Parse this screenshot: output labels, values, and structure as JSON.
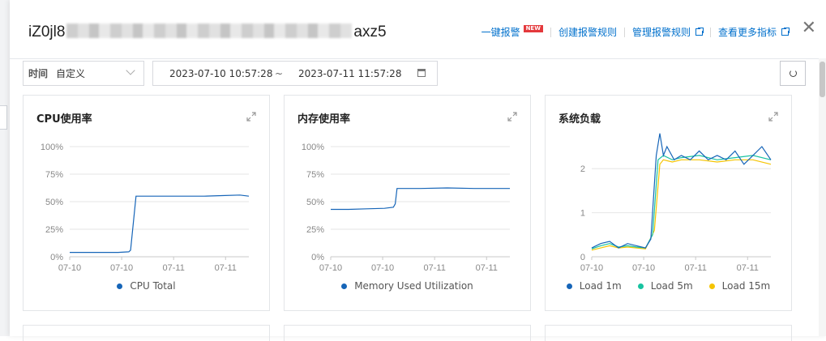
{
  "header": {
    "title_prefix": "iZ0jl8",
    "title_suffix": "axz5",
    "links": [
      {
        "label": "一键报警",
        "badge": "NEW"
      },
      {
        "label": "创建报警规则"
      },
      {
        "label": "管理报警规则"
      },
      {
        "label": "查看更多指标"
      }
    ],
    "close_glyph": "✕"
  },
  "toolbar": {
    "time_label": "时间",
    "time_value": "自定义",
    "range_start": "2023-07-10 10:57:28",
    "range_sep": "~",
    "range_end": "2023-07-11 11:57:28"
  },
  "colors": {
    "link": "#0070cc",
    "series_blue": "#1665b8",
    "series_teal": "#18c3a0",
    "series_yellow": "#f5c400"
  },
  "icons": [
    "expand-icon",
    "calendar-icon",
    "refresh-icon",
    "close-icon",
    "external-link-icon",
    "chevron-down-icon"
  ],
  "charts": [
    {
      "title": "CPU使用率",
      "chart_data": {
        "type": "line",
        "x_ticks": [
          "07-10",
          "07-10",
          "07-11",
          "07-11"
        ],
        "y_ticks": [
          "100%",
          "75%",
          "50%",
          "25%",
          "0%"
        ],
        "ylim": [
          0,
          100
        ],
        "series": [
          {
            "name": "CPU Total",
            "color": "#1665b8",
            "x": [
              0,
              0.2,
              0.27,
              0.33,
              0.34,
              0.37,
              0.45,
              0.55,
              0.65,
              0.75,
              0.85,
              0.95,
              1.0
            ],
            "y": [
              4,
              4,
              4,
              4.5,
              6,
              55,
              55,
              55,
              55,
              55,
              55.5,
              56,
              55
            ]
          }
        ],
        "legend": [
          "CPU Total"
        ]
      }
    },
    {
      "title": "内存使用率",
      "chart_data": {
        "type": "line",
        "x_ticks": [
          "07-10",
          "07-10",
          "07-11",
          "07-11"
        ],
        "y_ticks": [
          "100%",
          "75%",
          "50%",
          "25%",
          "0%"
        ],
        "ylim": [
          0,
          100
        ],
        "series": [
          {
            "name": "Memory Used Utilization",
            "color": "#1665b8",
            "x": [
              0,
              0.1,
              0.2,
              0.3,
              0.35,
              0.36,
              0.37,
              0.5,
              0.65,
              0.8,
              1.0
            ],
            "y": [
              43,
              43,
              43.5,
              44,
              45,
              48,
              62,
              62,
              62.5,
              62,
              62
            ]
          }
        ],
        "legend": [
          "Memory Used Utilization"
        ]
      }
    },
    {
      "title": "系统负载",
      "chart_data": {
        "type": "line",
        "x_ticks": [
          "07-10",
          "07-10",
          "07-11",
          "07-11"
        ],
        "y_ticks": [
          "2",
          "1",
          "0"
        ],
        "ylim": [
          0,
          2.5
        ],
        "series": [
          {
            "name": "Load 1m",
            "color": "#1665b8",
            "x": [
              0,
              0.05,
              0.1,
              0.15,
              0.2,
              0.25,
              0.3,
              0.33,
              0.36,
              0.38,
              0.4,
              0.42,
              0.46,
              0.5,
              0.55,
              0.6,
              0.65,
              0.7,
              0.75,
              0.8,
              0.85,
              0.9,
              0.95,
              1.0
            ],
            "y": [
              0.2,
              0.3,
              0.35,
              0.2,
              0.3,
              0.25,
              0.2,
              0.4,
              2.3,
              2.8,
              2.3,
              2.5,
              2.2,
              2.3,
              2.2,
              2.4,
              2.2,
              2.3,
              2.2,
              2.4,
              2.1,
              2.3,
              2.5,
              2.2
            ]
          },
          {
            "name": "Load 5m",
            "color": "#18c3a0",
            "x": [
              0,
              0.05,
              0.1,
              0.15,
              0.2,
              0.25,
              0.3,
              0.34,
              0.37,
              0.4,
              0.45,
              0.5,
              0.6,
              0.7,
              0.8,
              0.9,
              1.0
            ],
            "y": [
              0.18,
              0.25,
              0.3,
              0.22,
              0.25,
              0.22,
              0.2,
              0.5,
              2.2,
              2.3,
              2.2,
              2.25,
              2.3,
              2.2,
              2.25,
              2.3,
              2.2
            ]
          },
          {
            "name": "Load 15m",
            "color": "#f5c400",
            "x": [
              0,
              0.05,
              0.1,
              0.15,
              0.2,
              0.25,
              0.3,
              0.35,
              0.38,
              0.4,
              0.45,
              0.5,
              0.6,
              0.7,
              0.8,
              0.9,
              1.0
            ],
            "y": [
              0.15,
              0.2,
              0.25,
              0.2,
              0.22,
              0.2,
              0.18,
              0.6,
              2.1,
              2.2,
              2.15,
              2.2,
              2.2,
              2.15,
              2.2,
              2.2,
              2.1
            ]
          }
        ],
        "legend": [
          "Load 1m",
          "Load 5m",
          "Load 15m"
        ]
      }
    }
  ]
}
